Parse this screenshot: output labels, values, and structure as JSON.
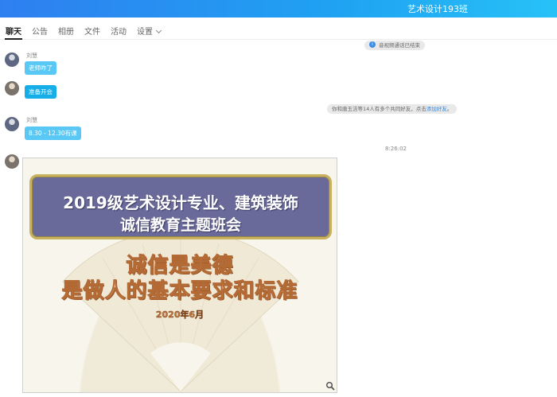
{
  "window": {
    "title": "艺术设计193班"
  },
  "tabs": [
    {
      "label": "聊天",
      "active": true
    },
    {
      "label": "公告"
    },
    {
      "label": "相册"
    },
    {
      "label": "文件"
    },
    {
      "label": "活动"
    },
    {
      "label": "设置",
      "dropdown": true
    }
  ],
  "messages": {
    "sys_call_end": {
      "icon": "info-icon",
      "text": "音视频通话已结束"
    },
    "msg1": {
      "sender": "刘慧",
      "text": "老师咋了"
    },
    "msg2": {
      "text": "准备开会"
    },
    "sys_friend": {
      "text": "你和唐玉洁等14人有多个共同好友，点击",
      "link": "添加好友",
      "suffix": "。"
    },
    "msg3": {
      "sender": "刘慧",
      "text": "8.30 - 12.30有课"
    },
    "timestamp": "8:26:02",
    "image": {
      "banner_line1": "2019级艺术设计专业、建筑装饰",
      "banner_line2": "诚信教育主题班会",
      "motto_line1": "诚信是美德",
      "motto_line2": "是做人的基本要求和标准",
      "date": "2020年6月",
      "zoom_icon": "magnifier-icon"
    }
  },
  "colors": {
    "accent": "#1fa2f2",
    "bubble_light": "#5ac8f5",
    "bubble_dark": "#16aee8",
    "link": "#2b8be6"
  }
}
